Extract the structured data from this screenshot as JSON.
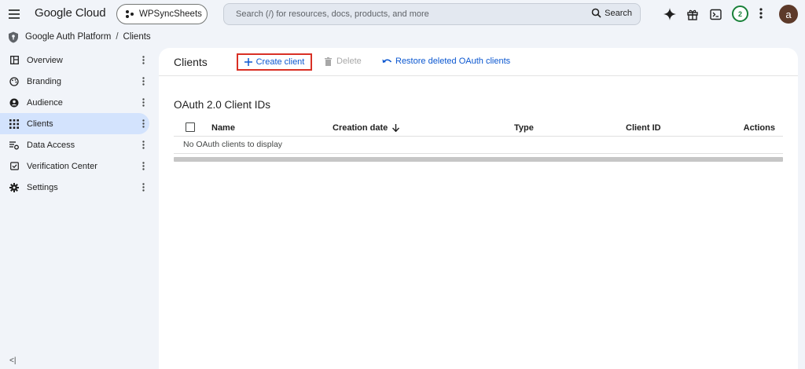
{
  "header": {
    "brand": "Google Cloud",
    "project": "WPSyncSheets",
    "search_placeholder": "Search (/) for resources, docs, products, and more",
    "search_button": "Search",
    "notification_count": "2",
    "avatar_initial": "a"
  },
  "breadcrumb": {
    "root": "Google Auth Platform",
    "separator": "/",
    "current": "Clients"
  },
  "sidebar": {
    "items": [
      {
        "label": "Overview",
        "icon": "dashboard-icon"
      },
      {
        "label": "Branding",
        "icon": "palette-icon"
      },
      {
        "label": "Audience",
        "icon": "account-circle-icon"
      },
      {
        "label": "Clients",
        "icon": "apps-grid-icon",
        "active": true
      },
      {
        "label": "Data Access",
        "icon": "data-access-icon"
      },
      {
        "label": "Verification Center",
        "icon": "verification-icon"
      },
      {
        "label": "Settings",
        "icon": "gear-icon"
      }
    ],
    "collapse_label": "<|"
  },
  "toolbar": {
    "title": "Clients",
    "create_label": "Create client",
    "delete_label": "Delete",
    "restore_label": "Restore deleted OAuth clients"
  },
  "table": {
    "title": "OAuth 2.0 Client IDs",
    "columns": [
      "Name",
      "Creation date",
      "Type",
      "Client ID",
      "Actions"
    ],
    "empty_message": "No OAuth clients to display"
  },
  "colors": {
    "accent": "#0b57d0",
    "highlight_border": "#d93025",
    "active_nav": "#d3e3fd",
    "background": "#f1f4f9"
  }
}
